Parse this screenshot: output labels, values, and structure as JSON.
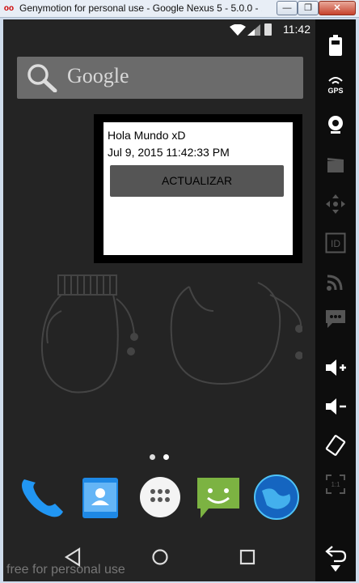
{
  "window": {
    "title": "Genymotion for personal use - Google Nexus 5 - 5.0.0 - ...",
    "minimize_label": "—",
    "maximize_label": "❐",
    "close_label": "✕"
  },
  "statusbar": {
    "time": "11:42"
  },
  "search": {
    "placeholder": "Google"
  },
  "widget": {
    "line1": "Hola Mundo xD",
    "line2": "Jul 9, 2015 11:42:33 PM",
    "button_label": "ACTUALIZAR"
  },
  "dock": {
    "apps": [
      "phone-icon",
      "contacts-icon",
      "app-drawer-icon",
      "messaging-icon",
      "browser-icon"
    ]
  },
  "nav": {
    "items": [
      "back-icon",
      "home-icon",
      "recents-icon"
    ]
  },
  "watermark": "free for personal use",
  "sidebar": {
    "gps_label": "GPS",
    "id_label": "ID",
    "zoom_label": "1:1"
  }
}
